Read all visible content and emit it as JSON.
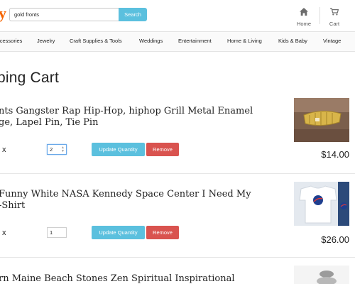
{
  "header": {
    "logo_glyph": "y",
    "search_value": "gold fronts",
    "search_button": "Search",
    "home_label": "Home",
    "cart_label": "Cart"
  },
  "categories": [
    "ccessories",
    "Jewelry",
    "Craft Supplies & Tools",
    "Weddings",
    "Entertainment",
    "Home & Living",
    "Kids & Baby",
    "Vintage"
  ],
  "page": {
    "title": "ping Cart"
  },
  "cart_items": [
    {
      "title": "nts Gangster Rap Hip-Hop, hiphop Grill Metal Enamel\nge, Lapel Pin, Tie Pin",
      "times": "x",
      "quantity": "2",
      "update_label": "Update Quantity",
      "remove_label": "Remove",
      "price": "$14.00"
    },
    {
      "title": "Funny White NASA Kennedy Space Center I Need My\n-Shirt",
      "times": "x",
      "quantity": "1",
      "update_label": "Update Quantity",
      "remove_label": "Remove",
      "price": "$26.00"
    },
    {
      "title": "rn Maine Beach Stones Zen Spiritual Inspirational"
    }
  ],
  "colors": {
    "brand": "#f56400",
    "info_button": "#5bc0de",
    "danger_button": "#d9534f"
  }
}
